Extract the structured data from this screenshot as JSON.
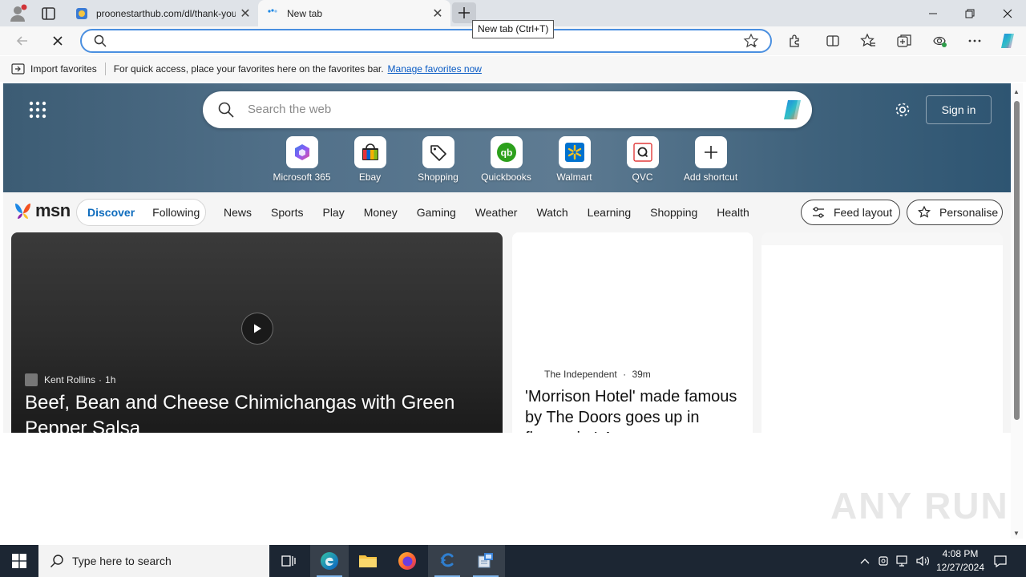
{
  "browser": {
    "tabs": [
      {
        "title": "proonestarthub.com/dl/thank-you",
        "close": "✕"
      },
      {
        "title": "New tab",
        "close": "✕"
      }
    ],
    "tooltip": "New tab (Ctrl+T)",
    "address": {
      "value": "",
      "placeholder": ""
    }
  },
  "favorites_bar": {
    "import_label": "Import favorites",
    "hint": "For quick access, place your favorites here on the favorites bar.",
    "manage_link": "Manage favorites now"
  },
  "newtab": {
    "search_placeholder": "Search the web",
    "sign_in": "Sign in",
    "shortcuts": [
      {
        "label": "Microsoft 365",
        "icon": "microsoft-365-icon"
      },
      {
        "label": "Ebay",
        "icon": "ebay-icon"
      },
      {
        "label": "Shopping",
        "icon": "shopping-tag-icon"
      },
      {
        "label": "Quickbooks",
        "icon": "quickbooks-icon"
      },
      {
        "label": "Walmart",
        "icon": "walmart-icon"
      },
      {
        "label": "QVC",
        "icon": "qvc-icon"
      },
      {
        "label": "Add shortcut",
        "icon": "plus-icon"
      }
    ]
  },
  "msn": {
    "logo": "msn",
    "tabs": {
      "discover": "Discover",
      "following": "Following"
    },
    "categories": [
      "News",
      "Sports",
      "Play",
      "Money",
      "Gaming",
      "Weather",
      "Watch",
      "Learning",
      "Shopping",
      "Health"
    ],
    "feed_layout": "Feed layout",
    "personalise": "Personalise",
    "cards": [
      {
        "source": "Kent Rollins",
        "age": "1h",
        "headline": "Beef, Bean and Cheese Chimichangas with Green Pepper Salsa"
      },
      {
        "source": "The Independent",
        "age": "39m",
        "headline": "'Morrison Hotel' made famous by The Doors goes up in flames in LA"
      }
    ]
  },
  "watermark": "ANY RUN",
  "taskbar": {
    "search_placeholder": "Type here to search",
    "time": "4:08 PM",
    "date": "12/27/2024"
  },
  "colors": {
    "accent": "#0f6cbd",
    "address_border": "#4a8fe0",
    "taskbar": "#1c2633"
  }
}
